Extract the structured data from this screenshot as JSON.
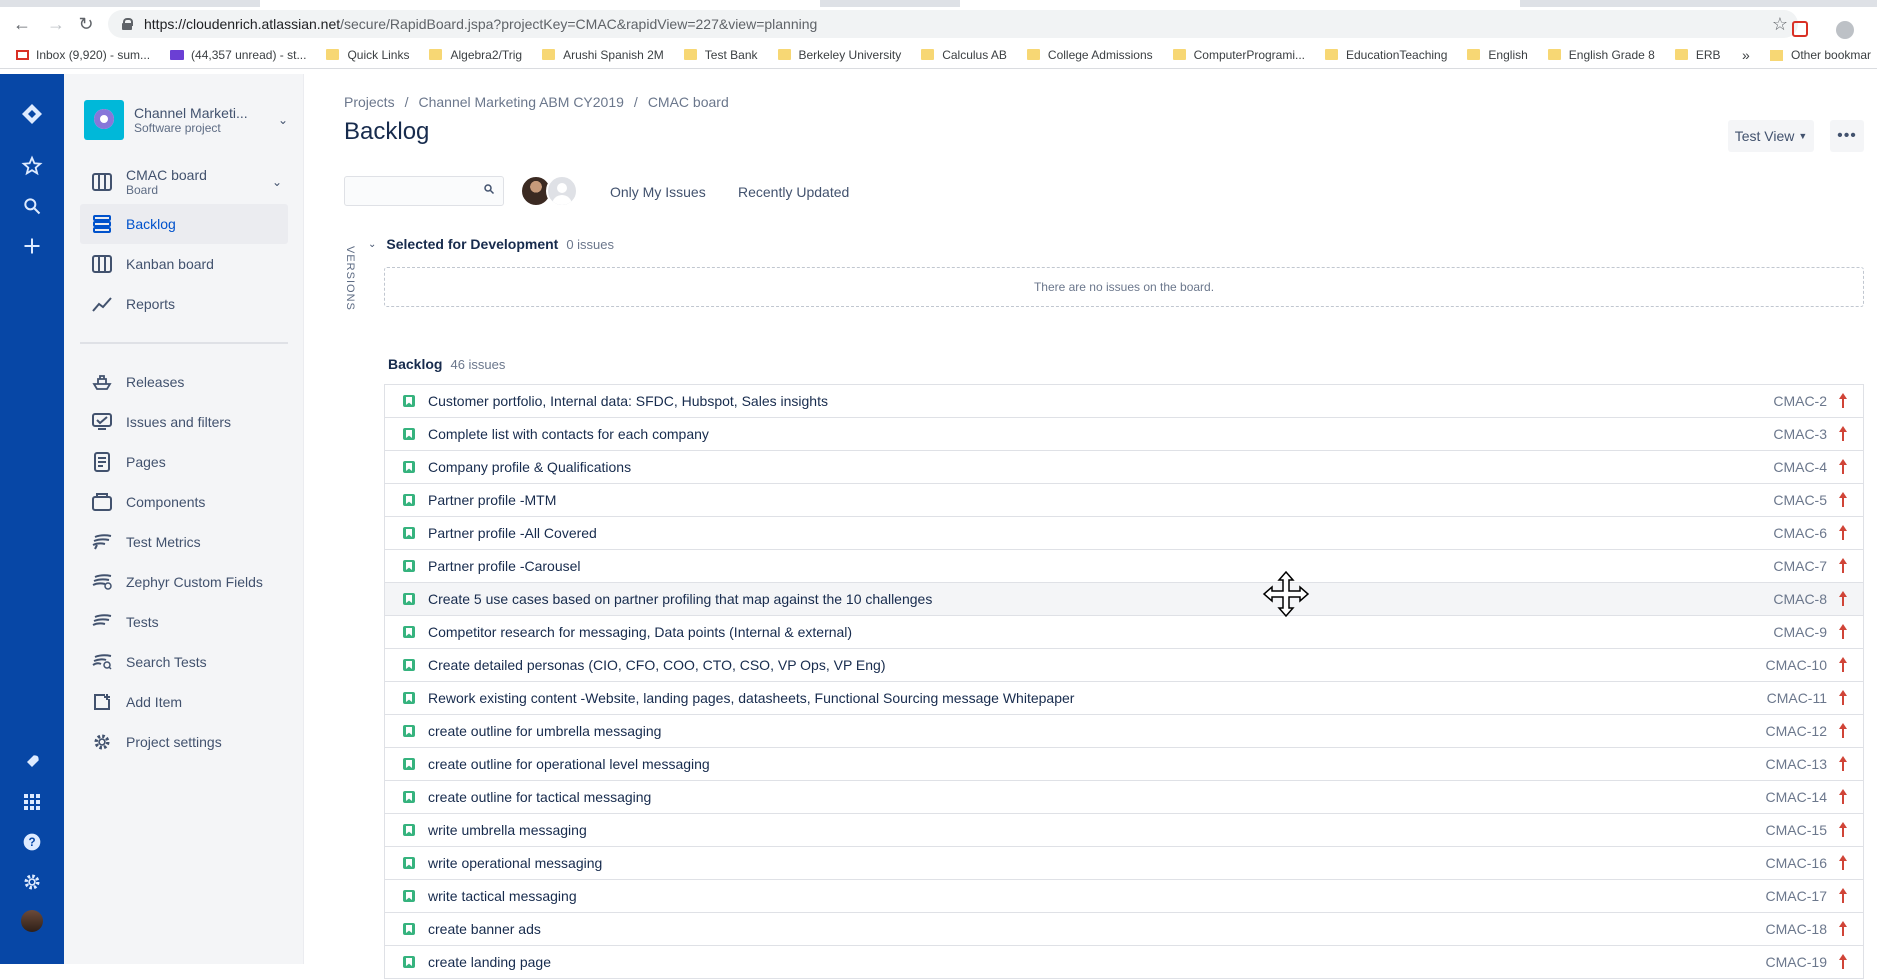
{
  "browser": {
    "url_host": "https://cloudenrich.atlassian.net",
    "url_path": "/secure/RapidBoard.jspa?projectKey=CMAC&rapidView=227&view=planning",
    "bookmarks": [
      {
        "icon": "gmail-icon",
        "label": "Inbox (9,920) - sum..."
      },
      {
        "icon": "yahoo-mail-icon",
        "label": "(44,357 unread) - st..."
      },
      {
        "icon": "folder-icon",
        "label": "Quick Links"
      },
      {
        "icon": "folder-icon",
        "label": "Algebra2/Trig"
      },
      {
        "icon": "folder-icon",
        "label": "Arushi Spanish 2M"
      },
      {
        "icon": "folder-icon",
        "label": "Test Bank"
      },
      {
        "icon": "folder-icon",
        "label": "Berkeley University"
      },
      {
        "icon": "folder-icon",
        "label": "Calculus AB"
      },
      {
        "icon": "folder-icon",
        "label": "College Admissions"
      },
      {
        "icon": "folder-icon",
        "label": "ComputerProgrami..."
      },
      {
        "icon": "folder-icon",
        "label": "EducationTeaching"
      },
      {
        "icon": "folder-icon",
        "label": "English"
      },
      {
        "icon": "folder-icon",
        "label": "English Grade 8"
      },
      {
        "icon": "folder-icon",
        "label": "ERB"
      }
    ],
    "bookmarks_more": "»",
    "other_bookmarks": "Other bookmar"
  },
  "sidebar": {
    "project_name": "Channel Marketi...",
    "project_type": "Software project",
    "board_name": "CMAC board",
    "board_sub": "Board",
    "items": [
      {
        "label": "Backlog",
        "icon": "backlog-icon"
      },
      {
        "label": "Kanban board",
        "icon": "board-icon"
      },
      {
        "label": "Reports",
        "icon": "reports-icon"
      },
      {
        "label": "Releases",
        "icon": "ship-icon"
      },
      {
        "label": "Issues and filters",
        "icon": "issues-icon"
      },
      {
        "label": "Pages",
        "icon": "page-icon"
      },
      {
        "label": "Components",
        "icon": "component-icon"
      },
      {
        "label": "Test Metrics",
        "icon": "zephyr-icon"
      },
      {
        "label": "Zephyr Custom Fields",
        "icon": "zephyr-icon"
      },
      {
        "label": "Tests",
        "icon": "zephyr-icon"
      },
      {
        "label": "Search Tests",
        "icon": "zephyr-search-icon"
      },
      {
        "label": "Add Item",
        "icon": "add-item-icon"
      },
      {
        "label": "Project settings",
        "icon": "gear-icon"
      }
    ]
  },
  "main": {
    "breadcrumb": [
      "Projects",
      "/",
      "Channel Marketing ABM CY2019",
      "/",
      "CMAC board"
    ],
    "title": "Backlog",
    "view_button": "Test View",
    "more_button": "•••",
    "search_placeholder": "",
    "filters": [
      "Only My Issues",
      "Recently Updated"
    ],
    "versions_label": "VERSIONS",
    "sprint": {
      "name": "Selected for Development",
      "count": "0 issues",
      "empty_text": "There are no issues on the board."
    },
    "backlog": {
      "name": "Backlog",
      "count": "46 issues",
      "issues": [
        {
          "summary": "Customer portfolio, Internal data: SFDC, Hubspot, Sales insights",
          "key": "CMAC-2"
        },
        {
          "summary": "Complete list with contacts for each company",
          "key": "CMAC-3"
        },
        {
          "summary": "Company profile & Qualifications",
          "key": "CMAC-4"
        },
        {
          "summary": "Partner profile -MTM",
          "key": "CMAC-5"
        },
        {
          "summary": "Partner profile -All Covered",
          "key": "CMAC-6"
        },
        {
          "summary": "Partner profile -Carousel",
          "key": "CMAC-7"
        },
        {
          "summary": "Create 5 use cases based on partner profiling that map against the 10 challenges",
          "key": "CMAC-8"
        },
        {
          "summary": "Competitor research for messaging, Data points (Internal & external)",
          "key": "CMAC-9"
        },
        {
          "summary": "Create detailed personas (CIO, CFO, COO, CTO, CSO, VP Ops, VP Eng)",
          "key": "CMAC-10"
        },
        {
          "summary": "Rework existing content -Website, landing pages, datasheets, Functional Sourcing message Whitepaper",
          "key": "CMAC-11"
        },
        {
          "summary": "create outline for umbrella messaging",
          "key": "CMAC-12"
        },
        {
          "summary": "create outline for operational level messaging",
          "key": "CMAC-13"
        },
        {
          "summary": "create outline for tactical messaging",
          "key": "CMAC-14"
        },
        {
          "summary": "write umbrella messaging",
          "key": "CMAC-15"
        },
        {
          "summary": "write operational messaging",
          "key": "CMAC-16"
        },
        {
          "summary": "write tactical messaging",
          "key": "CMAC-17"
        },
        {
          "summary": "create banner ads",
          "key": "CMAC-18"
        },
        {
          "summary": "create landing page",
          "key": "CMAC-19"
        }
      ]
    }
  },
  "colors": {
    "global_nav": "#0747a6",
    "story": "#36b37e",
    "priority_highest": "#d04437",
    "link_active": "#0052cc"
  }
}
